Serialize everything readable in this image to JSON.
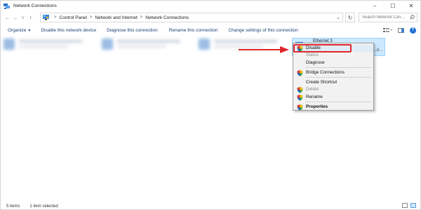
{
  "window": {
    "title": "Network Connections",
    "minimize": "–",
    "maximize": "☐",
    "close": "✕"
  },
  "nav": {
    "back": "←",
    "forward": "→",
    "recent": "˅",
    "up": "↑"
  },
  "address": {
    "breadcrumb": [
      "Control Panel",
      "Network and Internet",
      "Network Connections"
    ],
    "separator": ">",
    "dropdown": "⌄",
    "refresh": "↻"
  },
  "search": {
    "placeholder": "Search Network Con..."
  },
  "commands": {
    "organize": "Organize",
    "disable_device": "Disable this network device",
    "diagnose": "Diagnose this connection",
    "rename": "Rename this connection",
    "change_settings": "Change settings of this connection"
  },
  "help": "?",
  "selected_item": {
    "name": "Ethernet 3",
    "sub": "...d..."
  },
  "context_menu": {
    "items": [
      {
        "label": "Disable",
        "enabled": true,
        "shield": true
      },
      {
        "label": "Status",
        "enabled": false,
        "shield": false
      },
      {
        "label": "Diagnose",
        "enabled": true,
        "shield": false
      },
      {
        "label": "Bridge Connections",
        "enabled": true,
        "shield": true
      },
      {
        "label": "Create Shortcut",
        "enabled": true,
        "shield": false
      },
      {
        "label": "Delete",
        "enabled": false,
        "shield": true
      },
      {
        "label": "Rename",
        "enabled": true,
        "shield": true
      },
      {
        "label": "Properties",
        "enabled": true,
        "shield": true,
        "bold": true
      }
    ]
  },
  "status": {
    "item_count": "5 items",
    "selection": "1 item selected"
  },
  "colors": {
    "accent_red": "#e0262c",
    "selection_bg": "#cce8ff",
    "command_text": "#1a3e74"
  },
  "icons": [
    "control-panel-icon",
    "network-adapter-icon",
    "uac-shield-icon",
    "search-icon",
    "help-icon"
  ]
}
